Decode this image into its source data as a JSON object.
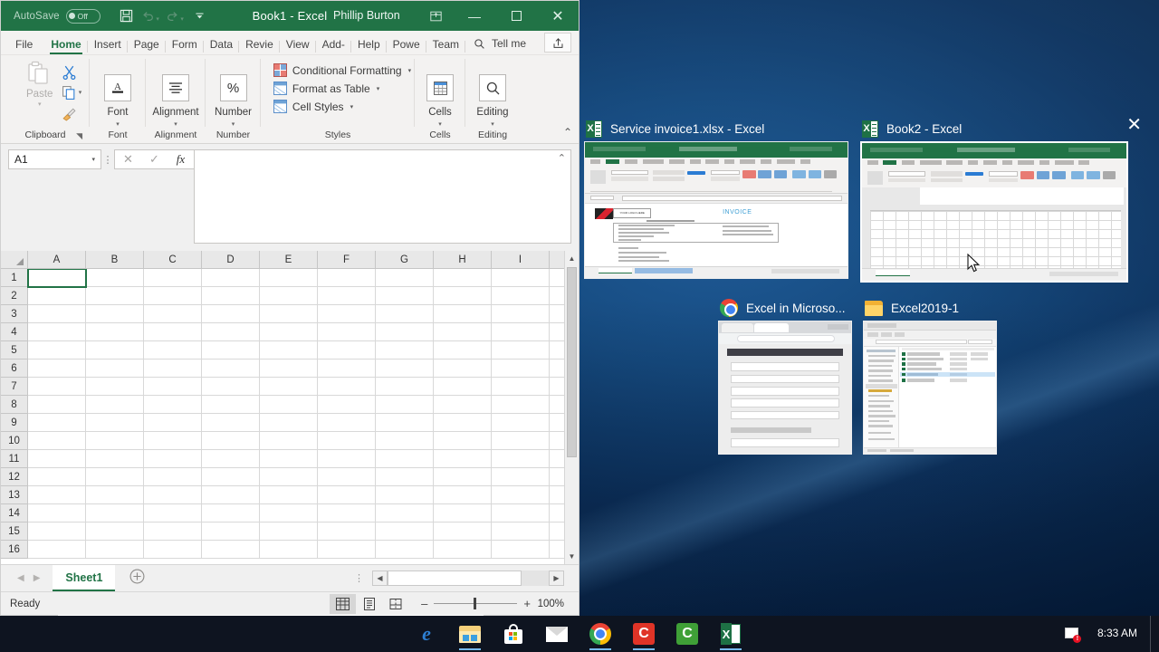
{
  "app": {
    "titlebar": {
      "autosave_label": "AutoSave",
      "autosave_state": "Off",
      "document_title": "Book1  -  Excel",
      "user_name": "Phillip Burton",
      "save_icon": "save-icon",
      "undo_icon": "undo-icon",
      "redo_icon": "redo-icon",
      "qat_customize_icon": "chevron-down-icon",
      "ribbon_display_icon": "ribbon-display-options-icon",
      "minimize_icon": "minimize-icon",
      "maximize_icon": "maximize-icon",
      "close_icon": "close-icon"
    },
    "tabs": [
      {
        "label": "File",
        "active": false
      },
      {
        "label": "Home",
        "active": true
      },
      {
        "label": "Insert",
        "active": false
      },
      {
        "label": "Page",
        "active": false
      },
      {
        "label": "Form",
        "active": false
      },
      {
        "label": "Data",
        "active": false
      },
      {
        "label": "Revie",
        "active": false
      },
      {
        "label": "View",
        "active": false
      },
      {
        "label": "Add-",
        "active": false
      },
      {
        "label": "Help",
        "active": false
      },
      {
        "label": "Powe",
        "active": false
      },
      {
        "label": "Team",
        "active": false
      }
    ],
    "tellme": {
      "label": "Tell me",
      "icon": "search-icon"
    },
    "share": {
      "label": "Share",
      "icon": "share-icon"
    },
    "ribbon": {
      "groups": [
        {
          "name": "Clipboard",
          "paste_label": "Paste"
        },
        {
          "name": "Font",
          "button": "Font"
        },
        {
          "name": "Alignment",
          "button": "Alignment"
        },
        {
          "name": "Number",
          "button": "Number"
        },
        {
          "name": "Styles",
          "items": [
            {
              "label": "Conditional Formatting"
            },
            {
              "label": "Format as Table"
            },
            {
              "label": "Cell Styles"
            }
          ]
        },
        {
          "name": "Cells",
          "button": "Cells"
        },
        {
          "name": "Editing",
          "button": "Editing"
        }
      ],
      "collapse_icon": "chevron-up-icon"
    },
    "formula_bar": {
      "name_box_value": "A1",
      "cancel_icon": "cancel-icon",
      "enter_icon": "check-icon",
      "insert_function_icon": "fx-icon",
      "formula_value": "",
      "expand_icon": "chevron-up-icon"
    },
    "grid": {
      "columns": [
        "A",
        "B",
        "C",
        "D",
        "E",
        "F",
        "G",
        "H",
        "I"
      ],
      "rows": [
        1,
        2,
        3,
        4,
        5,
        6,
        7,
        8,
        9,
        10,
        11,
        12,
        13,
        14,
        15,
        16
      ],
      "selected_cell": "A1"
    },
    "sheet_bar": {
      "prev_icon": "chevron-left-icon",
      "next_icon": "chevron-right-icon",
      "tabs": [
        {
          "label": "Sheet1",
          "active": true
        }
      ],
      "add_sheet_icon": "plus-circle-icon"
    },
    "status_bar": {
      "status": "Ready",
      "views": [
        {
          "name": "normal-view",
          "active": true
        },
        {
          "name": "page-layout-view",
          "active": false
        },
        {
          "name": "page-break-preview",
          "active": false
        }
      ],
      "zoom_out_label": "–",
      "zoom_in_label": "+",
      "zoom_level": "100%"
    }
  },
  "alt_tab": {
    "items": [
      {
        "title": "Service invoice1.xlsx - Excel",
        "icon": "excel-icon",
        "selected": false,
        "thumb_kind": "excel-invoice",
        "thumb_text": {
          "invoice_heading": "INVOICE",
          "logo_placeholder": "YOUR LOGO HERE",
          "sheet_tabs": [
            "Service invoice",
            "How to use this template"
          ]
        }
      },
      {
        "title": "Book2 - Excel",
        "icon": "excel-icon",
        "selected": true,
        "thumb_kind": "excel-blank",
        "close_icon": "close-icon",
        "thumb_text": {
          "sheet_tabs": [
            "Sheet1"
          ]
        }
      },
      {
        "title": "Excel in Microso...",
        "icon": "chrome-icon",
        "selected": false,
        "thumb_kind": "browser"
      },
      {
        "title": "Excel2019-1",
        "icon": "folder-icon",
        "selected": false,
        "thumb_kind": "file-explorer"
      }
    ]
  },
  "taskbar": {
    "items": [
      {
        "name": "edge-icon",
        "running": false
      },
      {
        "name": "file-explorer-icon",
        "running": true
      },
      {
        "name": "microsoft-store-icon",
        "running": false
      },
      {
        "name": "mail-icon",
        "running": false
      },
      {
        "name": "chrome-icon",
        "running": true
      },
      {
        "name": "camtasia-icon",
        "running": true
      },
      {
        "name": "snagit-icon",
        "running": false
      },
      {
        "name": "excel-icon",
        "running": true
      }
    ],
    "tray": [
      {
        "name": "network-error-icon",
        "badge": "!"
      }
    ],
    "clock": {
      "time": "8:33 AM"
    }
  },
  "colors": {
    "excel_green": "#217346",
    "desktop_blue": "#0d3461",
    "taskbar": "#0e1420",
    "accent_red": "#e81123"
  }
}
